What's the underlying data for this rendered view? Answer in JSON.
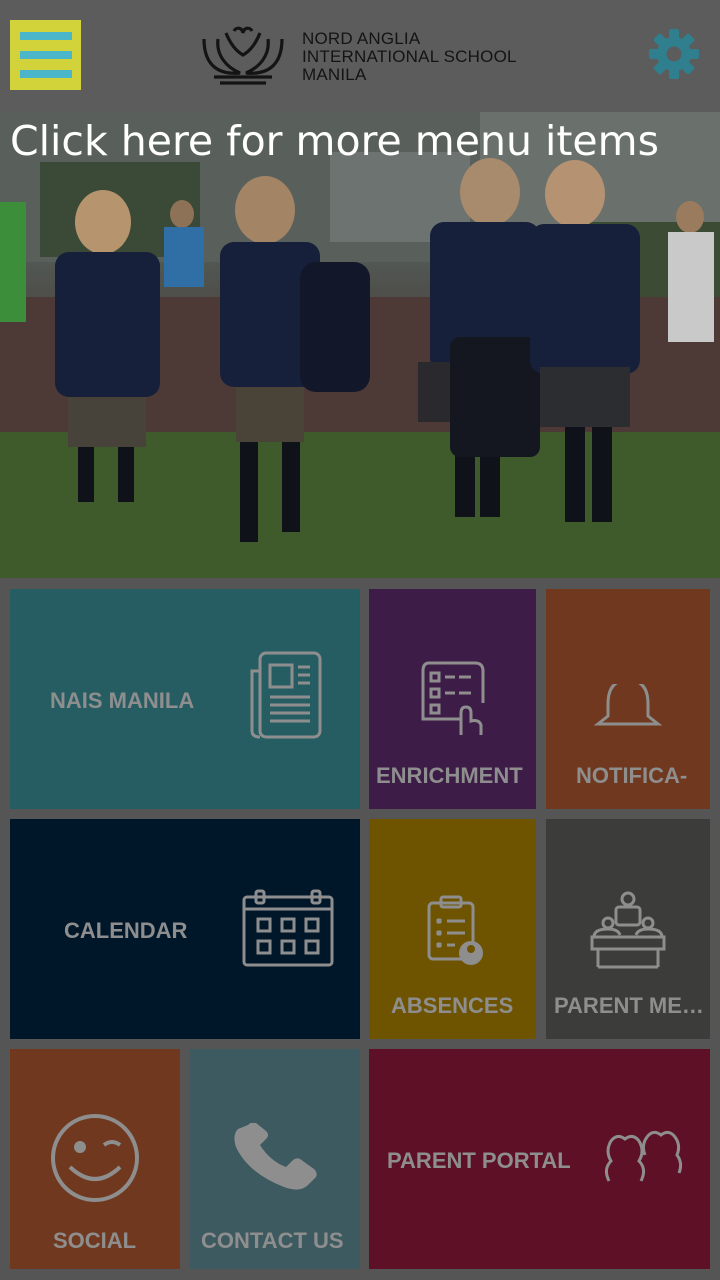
{
  "header": {
    "logo_line1": "NORD ANGLIA",
    "logo_line2": "INTERNATIONAL SCHOOL",
    "logo_line3": "MANILA",
    "menu_icon": "hamburger-icon",
    "settings_icon": "gear-icon"
  },
  "hero": {
    "caption": "Click here for more menu items"
  },
  "tiles": [
    {
      "label": "NAIS MANILA",
      "icon": "newspaper-icon",
      "color": "#265d62"
    },
    {
      "label": "ENRICHMENT",
      "icon": "checklist-icon",
      "color": "#3d1c48"
    },
    {
      "label": "NOTIFICA-",
      "icon": "bell-icon",
      "color": "#70391f"
    },
    {
      "label": "CALENDAR",
      "icon": "calendar-icon",
      "color": "#00172a"
    },
    {
      "label": "ABSENCES",
      "icon": "clipboard-icon",
      "color": "#6e5300"
    },
    {
      "label": "PARENT ME…",
      "icon": "meeting-icon",
      "color": "#3c3c3b"
    },
    {
      "label": "SOCIAL",
      "icon": "wink-face-icon",
      "color": "#70391f"
    },
    {
      "label": "CONTACT US",
      "icon": "phone-icon",
      "color": "#3d5a60"
    },
    {
      "label": "PARENT PORTAL",
      "icon": "users-icon",
      "color": "#5e1126"
    }
  ]
}
